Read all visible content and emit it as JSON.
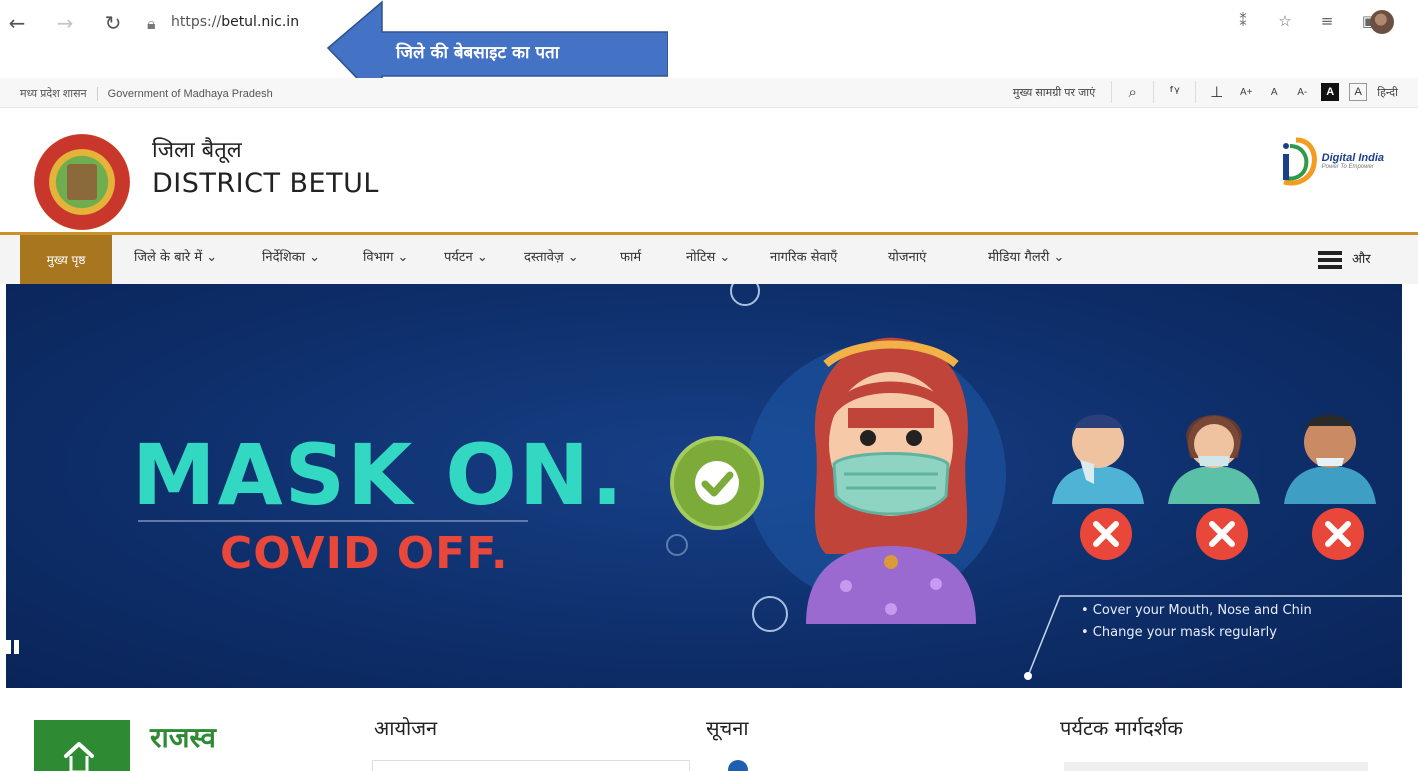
{
  "browser": {
    "url_prefix": "https://",
    "url_domain": "betul.nic.in",
    "back_icon": "arrow-left-icon",
    "forward_icon": "arrow-right-icon",
    "refresh_icon": "refresh-icon",
    "lock_icon": "lock-icon"
  },
  "callout": {
    "text": "जिले की बेबसाइट का पता",
    "color": "#4472c4"
  },
  "gov_strip": {
    "left_hi": "मध्य प्रदेश शासन",
    "left_en": "Government of Madhaya Pradesh",
    "skip_label": "मुख्य सामग्री पर जाएं",
    "font_increase": "A+",
    "font_normal": "A",
    "font_decrease": "A-",
    "contrast_dark": "A",
    "contrast_light": "A",
    "language": "हिन्दी"
  },
  "header": {
    "title_hi": "जिला बैतूल",
    "title_en": "DISTRICT BETUL",
    "digital_india": "Digital India",
    "digital_india_sub": "Power To Empower"
  },
  "nav": {
    "home": "मुख्य पृष्ठ",
    "items": [
      "जिले के बारे में ⌄",
      "निर्देशिका ⌄",
      "विभाग ⌄",
      "पर्यटन ⌄",
      "दस्तावेज़ ⌄",
      "फार्म",
      "नोटिस ⌄",
      "नागरिक सेवाएँ",
      "योजनाएं",
      "मीडिया गैलरी ⌄"
    ],
    "more": "और"
  },
  "banner": {
    "headline": "MASK ON.",
    "subheadline": "COVID OFF.",
    "tips": [
      "• Cover your Mouth, Nose and Chin",
      "• Change your mask regularly"
    ],
    "colors": {
      "headline": "#33d8c2",
      "subheadline": "#e8473a",
      "background": "#0e2f6b"
    }
  },
  "sections": {
    "revenue": "राजस्व",
    "events": "आयोजन",
    "notices": "सूचना",
    "tourist_guide": "पर्यटक मार्गदर्शक"
  }
}
